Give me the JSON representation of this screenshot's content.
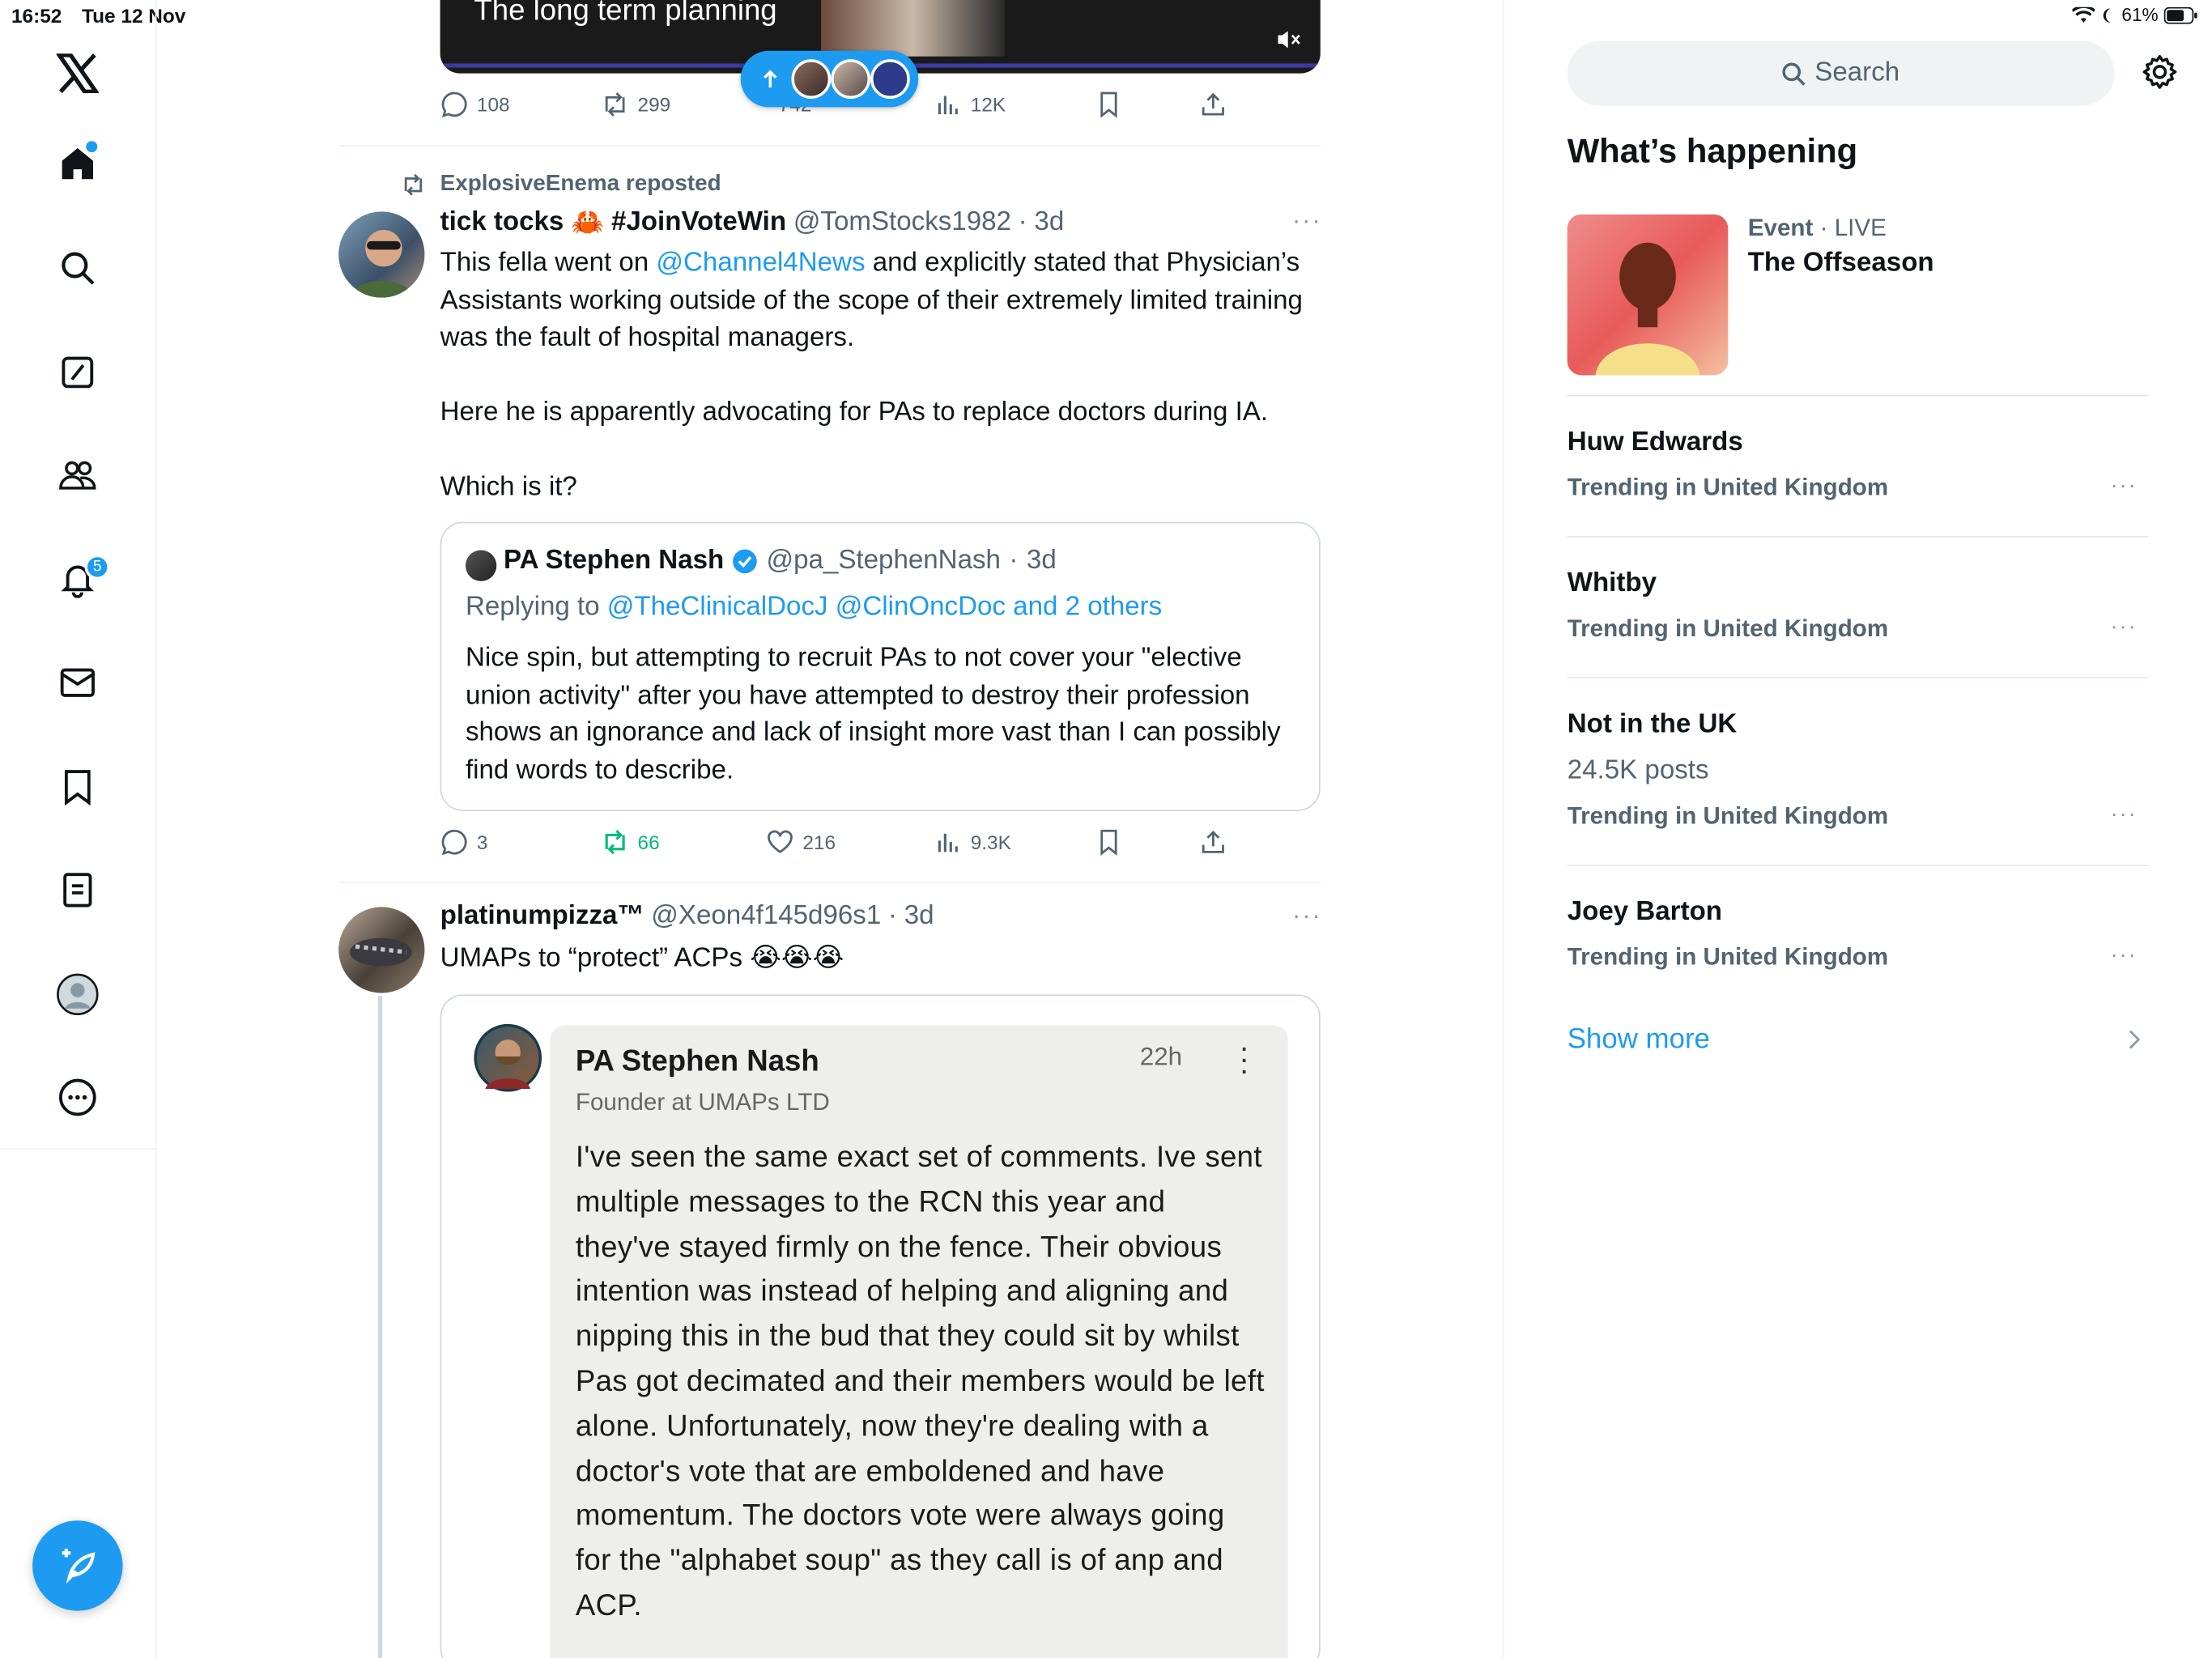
{
  "status_bar": {
    "time": "16:52",
    "date": "Tue 12 Nov",
    "battery": "61%"
  },
  "nav": {
    "notifications_badge": "5"
  },
  "top_video": {
    "title": "The long term planning"
  },
  "top_actions": {
    "replies": "108",
    "reposts": "299",
    "likes": "742",
    "views": "12K"
  },
  "tweet1": {
    "reposted_by": "ExplosiveEnema reposted",
    "name": "tick tocks",
    "name_emoji": "🦀",
    "hashtag": "#JoinVoteWin",
    "handle": "@TomStocks1982",
    "time": "3d",
    "text_a": "This fella went on ",
    "mention": "@Channel4News",
    "text_b": " and explicitly stated that Physician’s Assistants working outside of the scope of their extremely limited training was the fault of hospital managers.",
    "para2": "Here he is apparently advocating for PAs to replace doctors during IA.",
    "para3": "Which is it?",
    "quote": {
      "name": "PA Stephen Nash",
      "handle": "@pa_StephenNash",
      "time": "3d",
      "replying_prefix": "Replying to ",
      "replying_to": "@TheClinicalDocJ @ClinOncDoc and 2 others",
      "text": "Nice spin, but attempting to recruit PAs to not cover your \"elective union activity\" after you have attempted to destroy their profession shows an ignorance and lack of insight more vast than I can possibly find words to describe."
    },
    "actions": {
      "replies": "3",
      "reposts": "66",
      "likes": "216",
      "views": "9.3K"
    }
  },
  "tweet2": {
    "name": "platinumpizza™",
    "handle": "@Xeon4f145d96s1",
    "time": "3d",
    "text": "UMAPs to “protect” ACPs 😭😭😭",
    "linkedin": {
      "name": "PA Stephen Nash",
      "headline": "Founder at UMAPs LTD",
      "time": "22h",
      "text": "I've seen the same exact set of comments. Ive sent multiple messages to the RCN this year and they've stayed firmly on the fence. Their obvious intention was instead of helping and aligning and nipping this in the bud that they could sit by whilst Pas got decimated and their members would be left alone. Unfortunately, now they're dealing with a doctor's vote that are emboldened and have momentum. The doctors vote were always going for the \"alphabet soup\" as they call is of anp and ACP."
    }
  },
  "sidebar": {
    "search_placeholder": "Search",
    "heading": "What’s happening",
    "event": {
      "category": "Event",
      "status": "LIVE",
      "title": "The Offseason"
    },
    "trends": [
      {
        "title": "Huw Edwards",
        "subtitle": "Trending in United Kingdom"
      },
      {
        "title": "Whitby",
        "subtitle": "Trending in United Kingdom"
      },
      {
        "title": "Not in the UK",
        "posts": "24.5K posts",
        "subtitle": "Trending in United Kingdom"
      },
      {
        "title": "Joey Barton",
        "subtitle": "Trending in United Kingdom"
      }
    ],
    "show_more": "Show more"
  }
}
